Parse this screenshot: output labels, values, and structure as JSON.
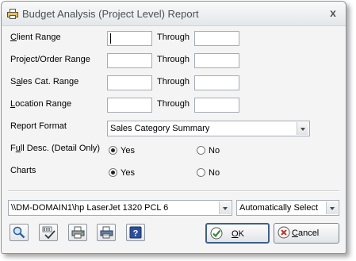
{
  "window": {
    "title": "Budget Analysis (Project Level) Report",
    "close_glyph": "x"
  },
  "ranges": [
    {
      "label": "Client Range",
      "accel": "C",
      "rest": "lient Range",
      "from": "",
      "to": ""
    },
    {
      "label": "Project/Order Range",
      "from": "",
      "to": ""
    },
    {
      "label": "Sales Cat. Range",
      "accel": "a",
      "pre": "S",
      "rest": "les Cat. Range",
      "from": "",
      "to": ""
    },
    {
      "label": "Location Range",
      "accel": "L",
      "rest": "ocation Range",
      "from": "",
      "to": ""
    }
  ],
  "through_label": "Through",
  "report_format": {
    "label": "Report Format",
    "value": "Sales Category Summary"
  },
  "full_desc": {
    "label_pre": "F",
    "label_accel": "u",
    "label_rest": "ll Desc. (Detail Only)",
    "yes": "Yes",
    "no": "No",
    "selected": "Yes"
  },
  "charts": {
    "label": "Charts",
    "yes": "Yes",
    "no": "No",
    "selected": "Yes"
  },
  "printer": {
    "value": "\\\\DM-DOMAIN1\\hp LaserJet 1320 PCL 6",
    "tray": "Automatically Select"
  },
  "toolbar_icons": [
    "preview-icon",
    "spellcheck-icon",
    "print-setup-icon",
    "print-icon",
    "help-icon"
  ],
  "buttons": {
    "ok": {
      "accel": "O",
      "rest": "K"
    },
    "cancel": {
      "accel": "C",
      "rest": "ancel"
    }
  },
  "colors": {
    "ok_check": "#2e8a2e",
    "cancel_x": "#c0392b",
    "help_blue": "#2b4f9e"
  }
}
